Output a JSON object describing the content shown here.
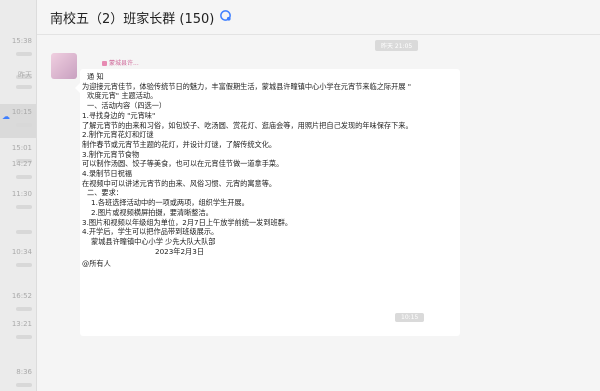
{
  "sidebar": {
    "items": [
      {
        "time": "15:38"
      },
      {
        "time": ""
      },
      {
        "time": "昨天"
      },
      {
        "time": "10:15",
        "active": true
      },
      {
        "time": "15:01"
      },
      {
        "time": "14:27"
      },
      {
        "time": "11:30"
      },
      {
        "time": ""
      },
      {
        "time": "10:34"
      },
      {
        "time": "16:52"
      },
      {
        "time": "13:21"
      },
      {
        "time": "8:36"
      }
    ]
  },
  "header": {
    "title": "南校五（2）班家长群 (150)",
    "icon": "group-cloud-icon"
  },
  "chat": {
    "time_top": "昨天 21:05",
    "time_bottom": "10:15",
    "sender": "蒙城县许...",
    "message": {
      "heading": "通  知",
      "lines": [
        "为迎接元宵佳节，体验传统节日的魅力，丰富假期生活，蒙城县许疃镇中心小学在元宵节来临之际开展 \"",
        "欢度元宵\" 主题活动。",
        "一、活动内容（四选一）",
        "1.寻找身边的 \"元宵味\"",
        "了解元宵节的由来和习俗，如包饺子、吃汤圆、赏花灯、逛庙会等，用照片把自己发现的年味保存下来。",
        "2.制作元宵花灯和灯谜",
        "制作春节或元宵节主题的花灯，并设计灯谜，了解传统文化。",
        "3.制作元宵节食物",
        "可以制作汤圆、饺子等美食，也可以在元宵佳节做一道拿手菜。",
        "4.录制节日祝福",
        "在视频中可以讲述元宵节的由来、风俗习惯、元宵的寓意等。",
        "二、要求：",
        "1.各班选择活动中的一项或两项，组织学生开展。",
        "2.图片或视频横屏拍摄，要清晰整洁。",
        "3.图片和视频以年级组为单位，2月7日上午放学前统一发到班群。",
        "4.开学后，学生可以把作品带到班级展示。",
        "蒙城县许疃镇中心小学  少先大队大队部",
        "2023年2月3日",
        "@所有人"
      ]
    }
  }
}
